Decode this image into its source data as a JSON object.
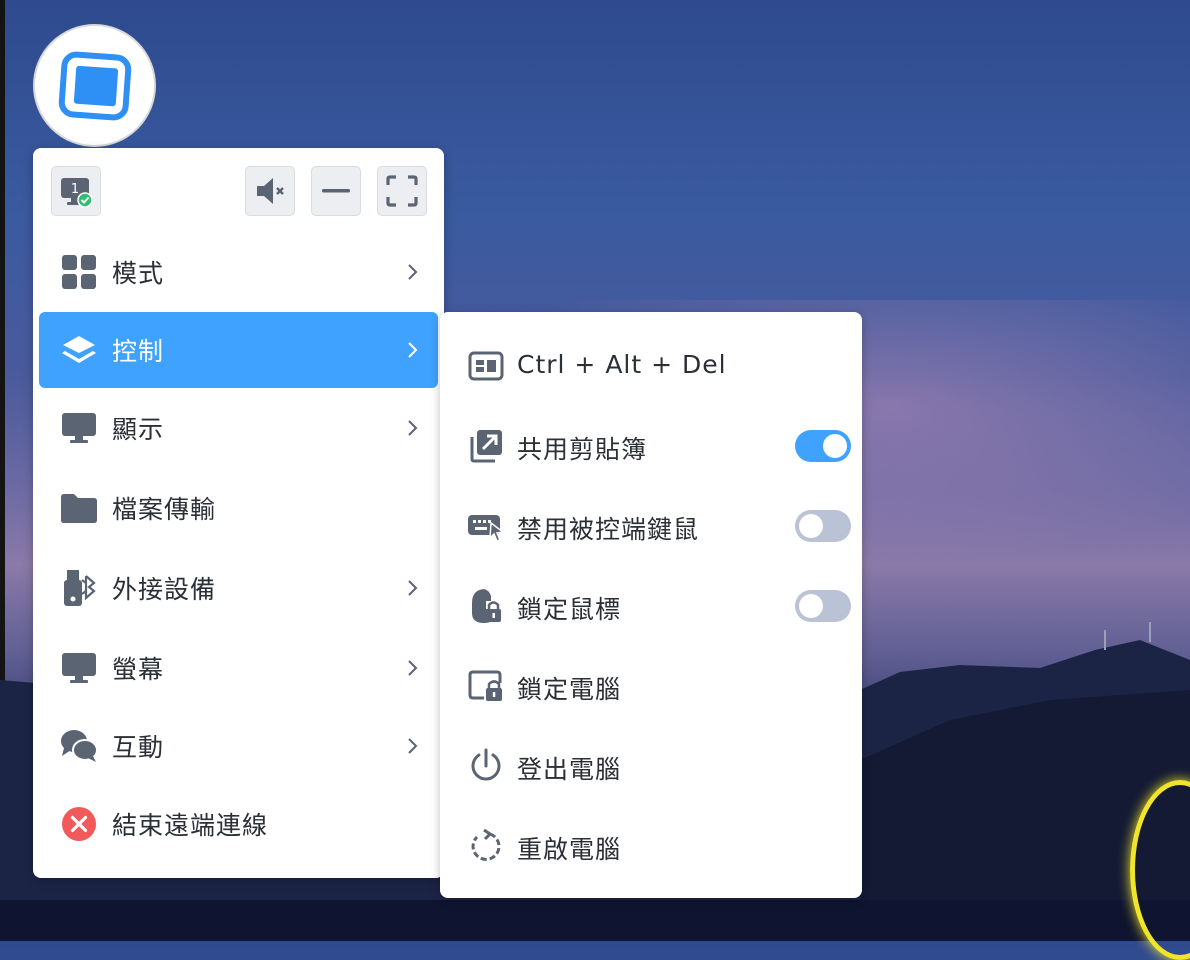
{
  "colors": {
    "accent": "#3fa2ff",
    "icon_gray": "#5b6473",
    "toggle_off": "#b9c3d5",
    "danger": "#f05a5a"
  },
  "app_logo": {
    "icon": "remote-display-logo"
  },
  "toolbar": {
    "monitor_number": "1",
    "monitor_icon": "monitor-check-icon",
    "mute_icon": "speaker-mute-icon",
    "minimize_icon": "minimize-icon",
    "fullscreen_icon": "fullscreen-icon"
  },
  "menu": {
    "items": [
      {
        "label": "模式",
        "icon": "grid-icon",
        "has_submenu": true,
        "active": false
      },
      {
        "label": "控制",
        "icon": "layers-icon",
        "has_submenu": true,
        "active": true
      },
      {
        "label": "顯示",
        "icon": "monitor-icon",
        "has_submenu": true,
        "active": false
      },
      {
        "label": "檔案傳輸",
        "icon": "folder-icon",
        "has_submenu": false,
        "active": false
      },
      {
        "label": "外接設備",
        "icon": "usb-bluetooth-icon",
        "has_submenu": true,
        "active": false
      },
      {
        "label": "螢幕",
        "icon": "screen-icon",
        "has_submenu": true,
        "active": false
      },
      {
        "label": "互動",
        "icon": "chat-icon",
        "has_submenu": true,
        "active": false
      },
      {
        "label": "結束遠端連線",
        "icon": "close-circle-icon",
        "has_submenu": false,
        "active": false
      }
    ]
  },
  "submenu": {
    "items": [
      {
        "label": "Ctrl + Alt + Del",
        "icon": "keyboard-combo-icon"
      },
      {
        "label": "共用剪貼簿",
        "icon": "clipboard-share-icon",
        "toggle": true,
        "value": true
      },
      {
        "label": "禁用被控端鍵鼠",
        "icon": "keyboard-mouse-icon",
        "toggle": true,
        "value": false
      },
      {
        "label": "鎖定鼠標",
        "icon": "mouse-lock-icon",
        "toggle": true,
        "value": false
      },
      {
        "label": "鎖定電腦",
        "icon": "computer-lock-icon"
      },
      {
        "label": "登出電腦",
        "icon": "power-icon"
      },
      {
        "label": "重啟電腦",
        "icon": "restart-icon"
      }
    ]
  }
}
